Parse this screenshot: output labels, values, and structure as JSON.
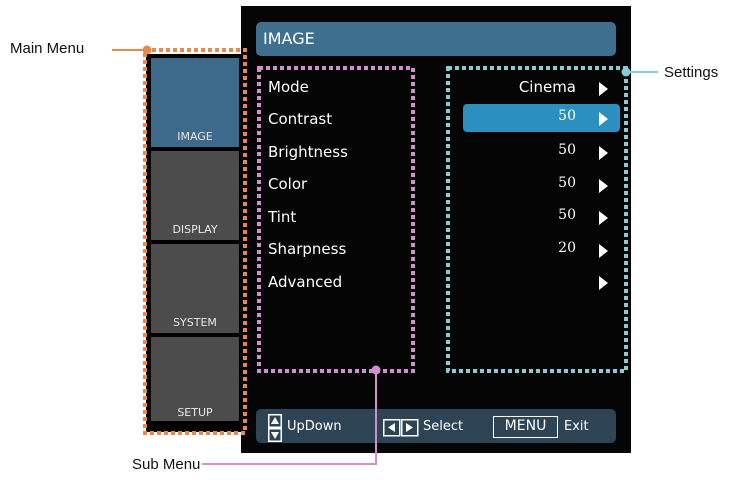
{
  "callouts": {
    "main_menu": "Main Menu",
    "settings": "Settings",
    "sub_menu": "Sub Menu"
  },
  "title": "IMAGE",
  "main_menu": {
    "items": [
      {
        "label": "IMAGE",
        "active": true
      },
      {
        "label": "DISPLAY",
        "active": false
      },
      {
        "label": "SYSTEM",
        "active": false
      },
      {
        "label": "SETUP",
        "active": false
      }
    ]
  },
  "sub_menu": {
    "items": [
      "Mode",
      "Contrast",
      "Brightness",
      "Color",
      "Tint",
      "Sharpness",
      "Advanced"
    ]
  },
  "settings": {
    "values": [
      "Cinema",
      "50",
      "50",
      "50",
      "50",
      "20",
      ""
    ]
  },
  "footer": {
    "updown_label": "UpDown",
    "select_label": "Select",
    "menu_key": "MENU",
    "exit_label": "Exit"
  },
  "colors": {
    "main_menu_outline": "#e8884a",
    "sub_menu_outline": "#d28fce",
    "settings_outline": "#86cdd6",
    "title_bar": "#3f6f8f",
    "active_setting": "#2b8fbf",
    "footer_bar": "#2e4455"
  }
}
